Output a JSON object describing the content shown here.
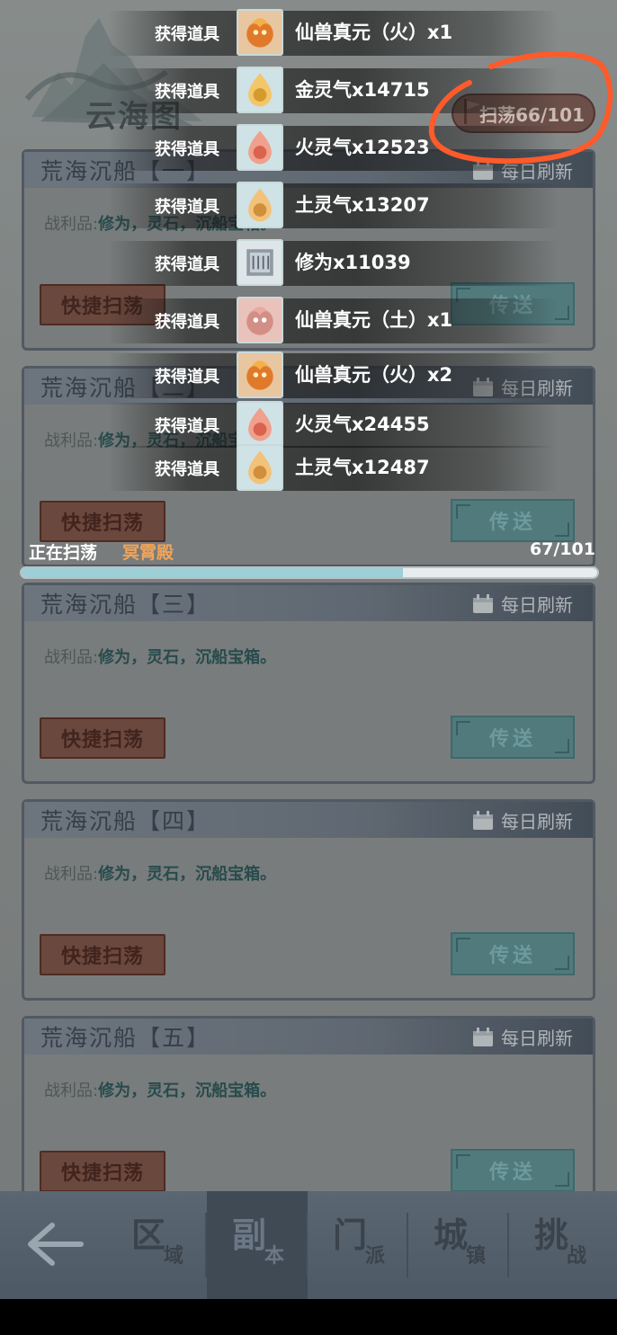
{
  "header": {
    "map_title": "云海图",
    "sweep_button": "扫荡66/101"
  },
  "cards": [
    {
      "title": "荒海沉船【一】",
      "refresh": "每日刷新",
      "loot_label": "战利品:",
      "loot_items": "修为，灵石，沉船宝箱。",
      "quick_sweep": "快捷扫荡",
      "teleport": "传送"
    },
    {
      "title": "荒海沉船【二】",
      "refresh": "每日刷新",
      "loot_label": "战利品:",
      "loot_items": "修为，灵石，沉船宝箱。",
      "quick_sweep": "快捷扫荡",
      "teleport": "传送"
    },
    {
      "title": "荒海沉船【三】",
      "refresh": "每日刷新",
      "loot_label": "战利品:",
      "loot_items": "修为，灵石，沉船宝箱。",
      "quick_sweep": "快捷扫荡",
      "teleport": "传送"
    },
    {
      "title": "荒海沉船【四】",
      "refresh": "每日刷新",
      "loot_label": "战利品:",
      "loot_items": "修为，灵石，沉船宝箱。",
      "quick_sweep": "快捷扫荡",
      "teleport": "传送"
    },
    {
      "title": "荒海沉船【五】",
      "refresh": "每日刷新",
      "loot_label": "战利品:",
      "loot_items": "修为，灵石，沉船宝箱。",
      "quick_sweep": "快捷扫荡",
      "teleport": "传送"
    }
  ],
  "rewards": [
    {
      "label": "获得道具",
      "icon": "beast-essence-fire-icon",
      "text": "仙兽真元（火）x1"
    },
    {
      "label": "获得道具",
      "icon": "gold-spirit-icon",
      "text": "金灵气x14715"
    },
    {
      "label": "获得道具",
      "icon": "fire-spirit-icon",
      "text": "火灵气x12523"
    },
    {
      "label": "获得道具",
      "icon": "earth-spirit-icon",
      "text": "土灵气x13207"
    },
    {
      "label": "获得道具",
      "icon": "cultivation-scroll-icon",
      "text": "修为x11039"
    },
    {
      "label": "获得道具",
      "icon": "beast-essence-earth-icon",
      "text": "仙兽真元（土）x1"
    },
    {
      "label": "获得道具",
      "icon": "beast-essence-fire-icon",
      "text": "仙兽真元（火）x2"
    },
    {
      "label": "获得道具",
      "icon": "fire-spirit-icon",
      "text": "火灵气x24455"
    },
    {
      "label": "获得道具",
      "icon": "earth-spirit-icon",
      "text": "土灵气x12487"
    }
  ],
  "progress": {
    "label": "正在扫荡",
    "target": "冥霄殿",
    "count": "67/101",
    "fraction": 0.663
  },
  "nav": {
    "items": [
      {
        "main": "区",
        "sub": "域"
      },
      {
        "main": "副",
        "sub": "本"
      },
      {
        "main": "门",
        "sub": "派"
      },
      {
        "main": "城",
        "sub": "镇"
      },
      {
        "main": "挑",
        "sub": "战"
      }
    ]
  },
  "colors": {
    "accent_orange": "#f2a457",
    "annotation_red": "#ff5a2a",
    "progress_fill": "#9ccfd6"
  }
}
